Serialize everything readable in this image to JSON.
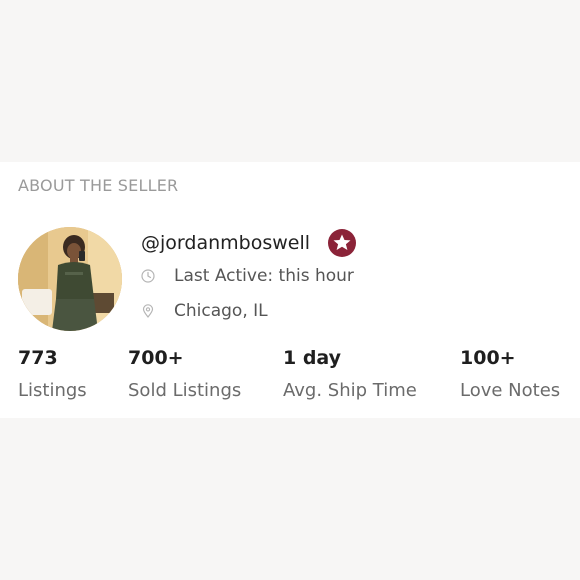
{
  "section": {
    "title": "ABOUT THE SELLER"
  },
  "seller": {
    "handle": "@jordanmboswell",
    "badge_icon": "star-badge-icon",
    "badge_color": "#8b2338",
    "last_active": "Last Active: this hour",
    "location": "Chicago, IL"
  },
  "stats": [
    {
      "value": "773",
      "label": "Listings"
    },
    {
      "value": "700+",
      "label": "Sold Listings"
    },
    {
      "value": "1 day",
      "label": "Avg. Ship Time"
    },
    {
      "value": "100+",
      "label": "Love Notes"
    }
  ]
}
